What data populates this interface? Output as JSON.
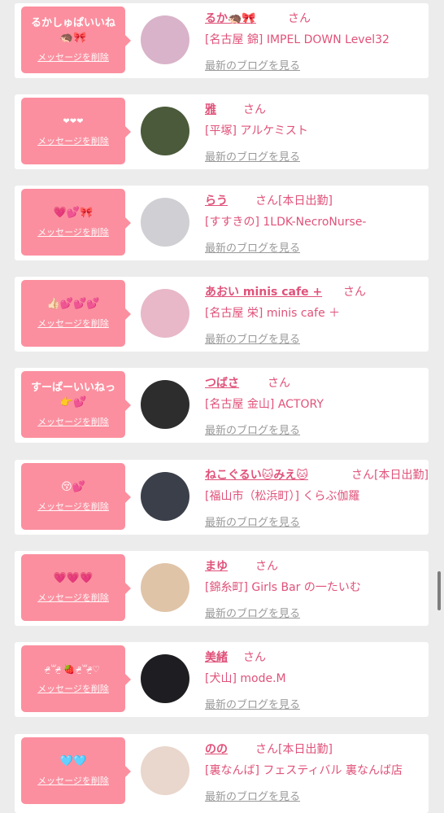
{
  "common": {
    "delete_label": "メッセージを削除",
    "blog_label": "最新のブログを見る",
    "honorific": "さん"
  },
  "colors": {
    "accent_pink": "#fb8f9f",
    "name_pink": "#e0527a",
    "blog_gray": "#9a9a9a",
    "background": "#ececec"
  },
  "messages": [
    {
      "text": "るかしゅぱいいね\n🦔🎀",
      "name": "るか🦔🎀",
      "suffix": "",
      "shop": "[名古屋 錦] IMPEL DOWN Level32",
      "avatar_color": "#d9b3c9"
    },
    {
      "text": "❤❤❤",
      "name": "雅",
      "suffix": "",
      "shop": "[平塚] アルケミスト",
      "avatar_color": "#4a5a3a"
    },
    {
      "text": "💗💕🎀",
      "name": "らう",
      "suffix": "[本日出勤]",
      "shop": "[すすきの] 1LDK-NecroNurse-",
      "avatar_color": "#cfcfd4"
    },
    {
      "text": "👍🏻💕💕💕",
      "name": "あおい minis cafe +",
      "suffix": "",
      "shop": "[名古屋 栄] minis cafe ＋",
      "avatar_color": "#e8b8c8"
    },
    {
      "text": "すーぱーいいねっ\n👉💕",
      "name": "つばさ",
      "suffix": "",
      "shop": "[名古屋 金山] ACTORY",
      "avatar_color": "#2d2d2d"
    },
    {
      "text": "😚💕",
      "name": "ねこぐるい🐱みえ🐱",
      "suffix": "[本日出勤]",
      "shop": "[福山市（松浜町）] くらぶ伽羅",
      "avatar_color": "#3a3f4a"
    },
    {
      "text": "💗💗💗",
      "name": "まゆ",
      "suffix": "",
      "shop": "[錦糸町] Girls Bar の一たいむ",
      "avatar_color": "#e0c4a8"
    },
    {
      "text": "ᵒ̴̶̷̤꒳ᵒ̴̶̷̤ 🍓 ᵒ̴̶̷̤꒳ᵒ̴̶̷̤♡",
      "name": "美緒",
      "suffix": "",
      "shop": "[犬山] mode.M",
      "avatar_color": "#1e1e22"
    },
    {
      "text": "🩵🩵",
      "name": "のの",
      "suffix": "[本日出勤]",
      "shop": "[裏なんば] フェスティバル 裏なんば店",
      "avatar_color": "#e9d6cc"
    }
  ]
}
